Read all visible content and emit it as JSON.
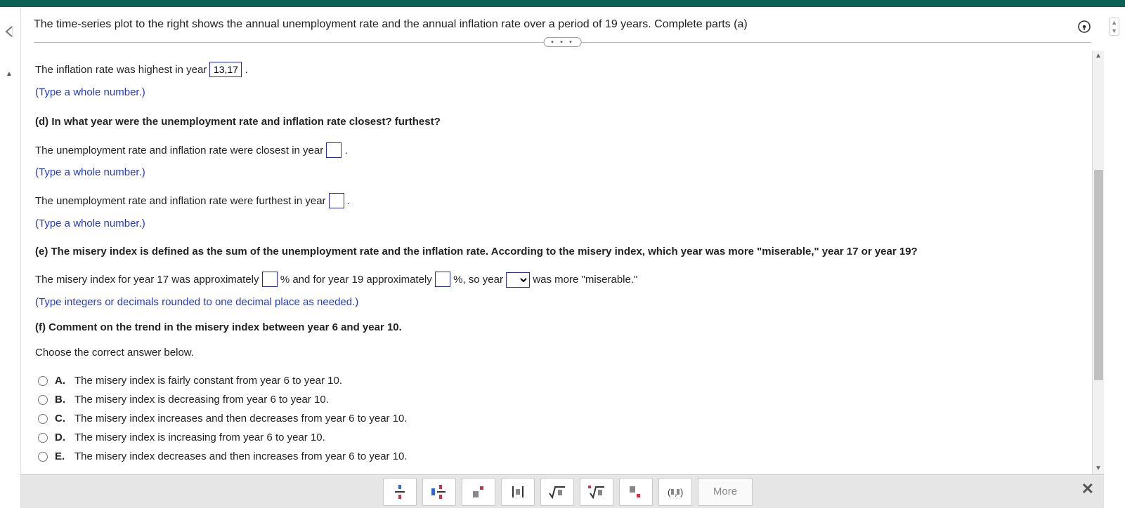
{
  "header": {
    "question_text": "The time-series plot to the right shows the annual unemployment rate and the annual inflation rate over a period of 19 years. Complete parts (a)"
  },
  "divider_dots": "• • •",
  "question": {
    "line1_pre": "The inflation rate was highest in year ",
    "line1_value": "13,17",
    "line1_post": ".",
    "hint_whole": "(Type a whole number.)",
    "part_d": "(d) In what year were the unemployment rate and inflation rate closest? furthest?",
    "closest_pre": "The unemployment rate and inflation rate were closest in year ",
    "closest_value": "",
    "closest_post": ".",
    "furthest_pre": "The unemployment rate and inflation rate were furthest in year ",
    "furthest_value": "",
    "furthest_post": ".",
    "part_e": "(e) The misery index is defined as the sum of the unemployment rate and the inflation rate. According to the misery index, which year was more \"miserable,\" year 17 or year 19?",
    "misery_pre": "The misery index for year 17 was approximately ",
    "misery_val17": "",
    "misery_mid1": "% and for year 19 approximately ",
    "misery_val19": "",
    "misery_mid2": "%, so year ",
    "misery_select": "",
    "misery_post": " was more \"miserable.\"",
    "hint_decimal": "(Type integers or decimals rounded to one decimal place as needed.)",
    "part_f": "(f) Comment on the trend in the misery index between year 6 and year 10.",
    "choose": "Choose the correct answer below.",
    "options": [
      {
        "letter": "A.",
        "text": "The misery index is fairly constant from year 6 to year 10."
      },
      {
        "letter": "B.",
        "text": "The misery index is decreasing from year 6 to year 10."
      },
      {
        "letter": "C.",
        "text": "The misery index increases and then decreases from year 6 to year 10."
      },
      {
        "letter": "D.",
        "text": "The misery index is increasing from year 6 to year 10."
      },
      {
        "letter": "E.",
        "text": "The misery index decreases and then increases from year 6 to year 10."
      }
    ]
  },
  "toolbar": {
    "more": "More"
  }
}
